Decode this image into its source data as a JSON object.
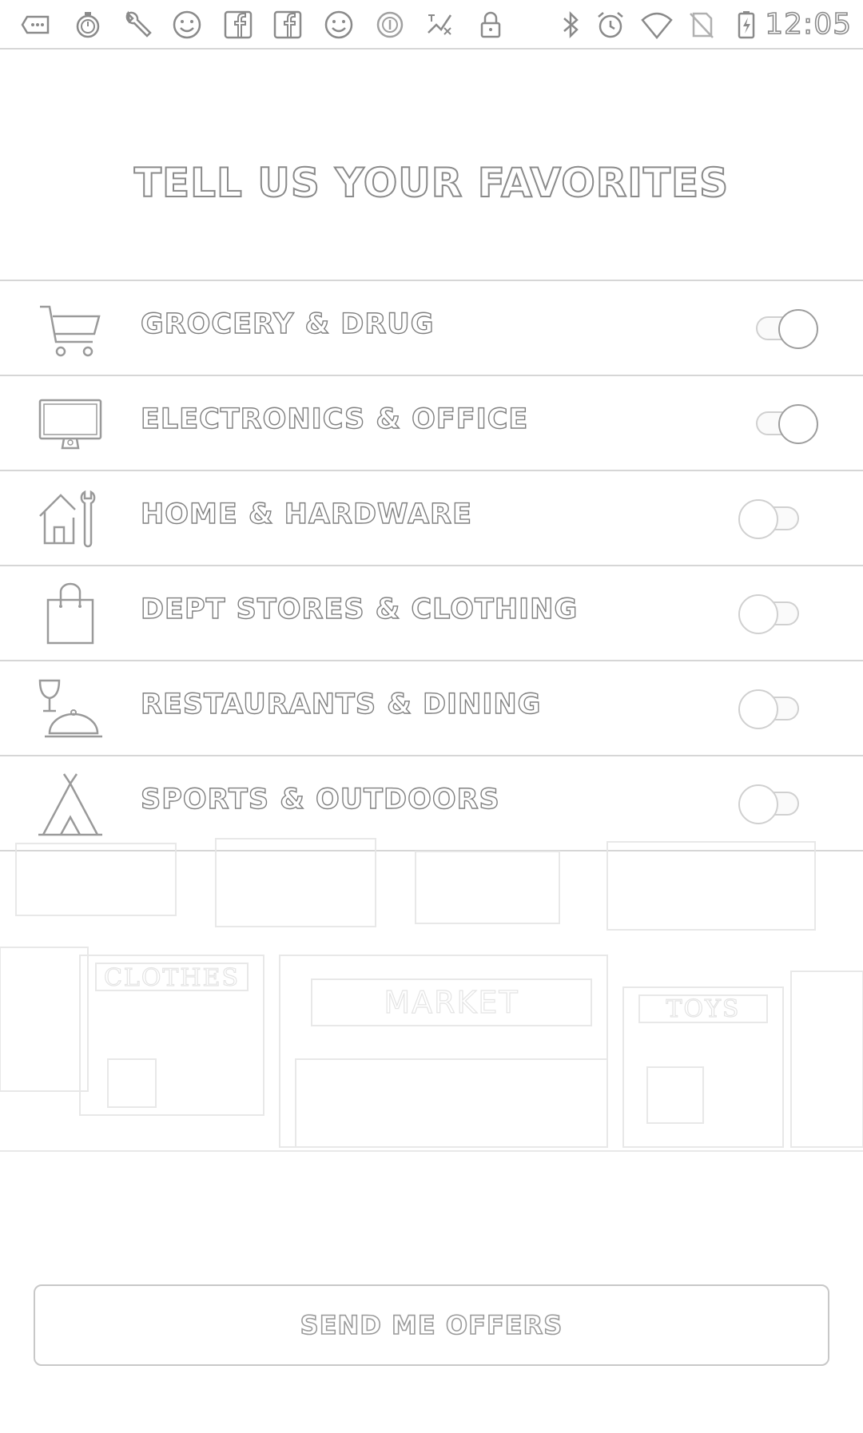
{
  "status_bar": {
    "time": "12:05",
    "left_icons": [
      "more-apps-icon",
      "stopwatch-icon",
      "wrench-icon",
      "smiley-icon",
      "facebook-icon",
      "facebook-icon-2",
      "smiley-icon-2",
      "app-circle-icon",
      "fav-app-icon",
      "lock-icon"
    ],
    "right_icons": [
      "bluetooth-icon",
      "alarm-icon",
      "wifi-icon",
      "no-sim-icon",
      "battery-charging-icon"
    ]
  },
  "header": {
    "title": "TELL US YOUR FAVORITES"
  },
  "categories": [
    {
      "label": "GROCERY & DRUG",
      "icon": "shopping-cart-icon",
      "enabled": true
    },
    {
      "label": "ELECTRONICS & OFFICE",
      "icon": "monitor-icon",
      "enabled": true
    },
    {
      "label": "HOME & HARDWARE",
      "icon": "home-hardware-icon",
      "enabled": false
    },
    {
      "label": "DEPT STORES & CLOTHING",
      "icon": "shopping-bag-icon",
      "enabled": false
    },
    {
      "label": "RESTAURANTS & DINING",
      "icon": "dining-icon",
      "enabled": false
    },
    {
      "label": "SPORTS & OUTDOORS",
      "icon": "tent-icon",
      "enabled": false
    }
  ],
  "storefront": {
    "signs": [
      "CLOTHES",
      "MARKET",
      "TOYS"
    ]
  },
  "cta": {
    "label": "SEND ME OFFERS"
  }
}
